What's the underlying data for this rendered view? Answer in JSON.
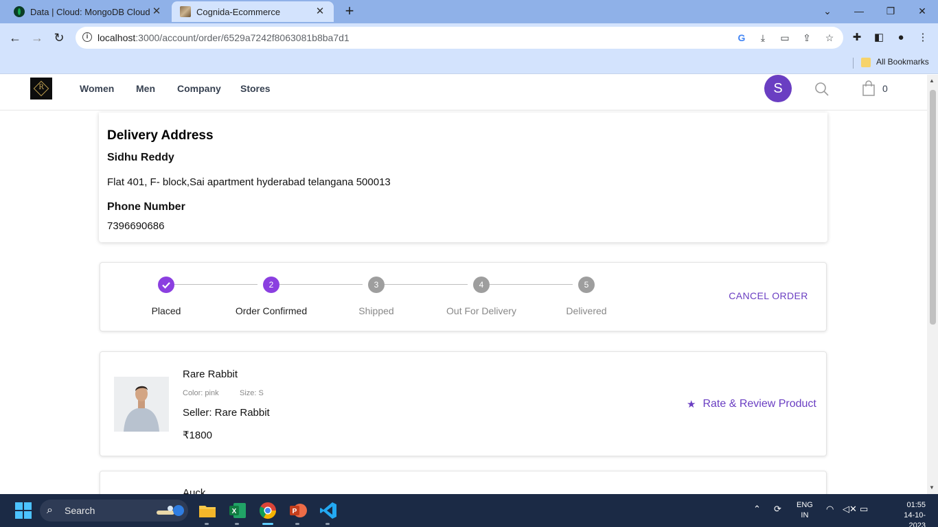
{
  "browser": {
    "tabs": [
      {
        "title": "Data | Cloud: MongoDB Cloud",
        "icon": "mongodb-leaf-icon",
        "active": false
      },
      {
        "title": "Cognida-Ecommerce",
        "icon": "site-favicon",
        "active": true
      }
    ],
    "url_host": "localhost",
    "url_path": ":3000/account/order/6529a7242f8063081b8ba7d1",
    "bookmarks_label": "All Bookmarks"
  },
  "header": {
    "nav": [
      "Women",
      "Men",
      "Company",
      "Stores"
    ],
    "avatar_initial": "S",
    "cart_count": "0",
    "avatar_color": "#6a3ec2"
  },
  "address": {
    "title": "Delivery Address",
    "name": "Sidhu Reddy",
    "line": "Flat 401, F- block,Sai apartment hyderabad telangana 500013",
    "phone_label": "Phone Number",
    "phone": "7396690686"
  },
  "tracker": {
    "steps": [
      {
        "num": "1",
        "label": "Placed",
        "state": "done"
      },
      {
        "num": "2",
        "label": "Order Confirmed",
        "state": "active"
      },
      {
        "num": "3",
        "label": "Shipped",
        "state": "pending"
      },
      {
        "num": "4",
        "label": "Out For Delivery",
        "state": "pending"
      },
      {
        "num": "5",
        "label": "Delivered",
        "state": "pending"
      }
    ],
    "cancel_label": "CANCEL ORDER",
    "accent_color": "#8b3fe0"
  },
  "items": [
    {
      "name": "Rare Rabbit",
      "color": "Color: pink",
      "size": "Size: S",
      "seller": "Seller: Rare Rabbit",
      "price": "₹1800",
      "rate_label": "Rate & Review Product"
    },
    {
      "name": "Auck"
    }
  ],
  "taskbar": {
    "search_label": "Search",
    "lang_top": "ENG",
    "lang_bottom": "IN",
    "time": "01:55",
    "date": "14-10-2023"
  }
}
